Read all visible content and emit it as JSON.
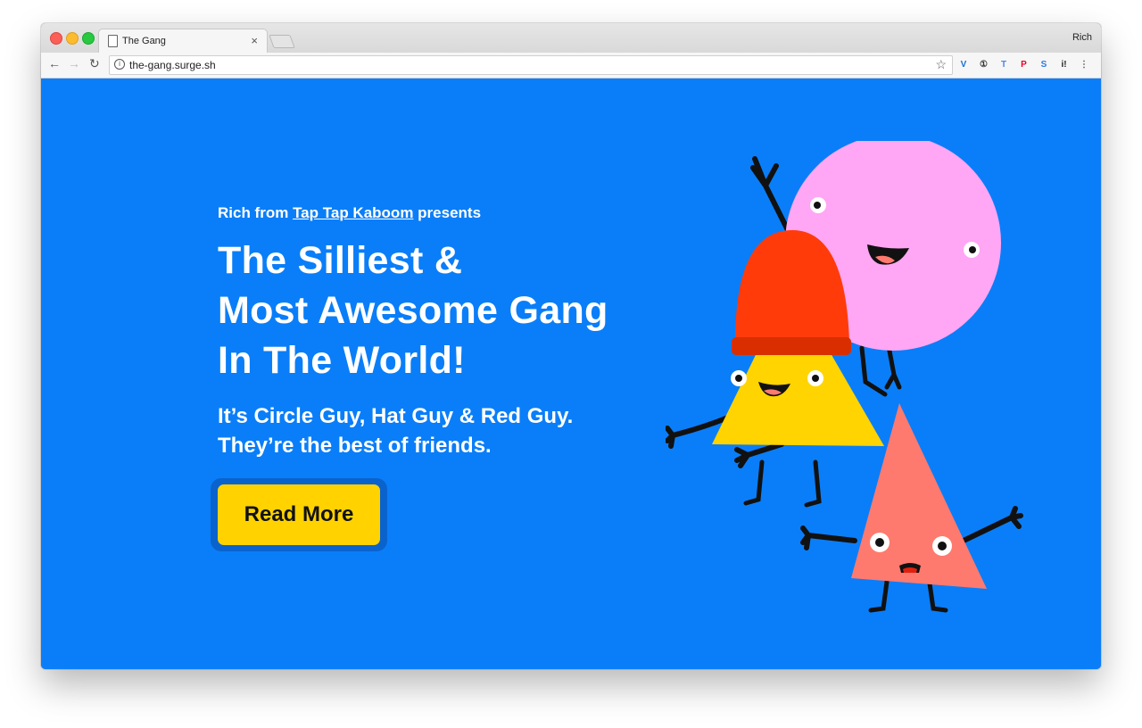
{
  "browser": {
    "tab_title": "The Gang",
    "tab_close": "×",
    "profile_name": "Rich",
    "url": "the-gang.surge.sh",
    "back": "←",
    "forward": "→",
    "reload": "↻",
    "info_glyph": "i",
    "star": "☆",
    "extensions": [
      {
        "name": "vimeo-icon",
        "glyph": "V",
        "color": "#1a6fd6"
      },
      {
        "name": "onepassword-icon",
        "glyph": "①",
        "color": "#333333"
      },
      {
        "name": "translate-icon",
        "glyph": "T",
        "color": "#4a86e8"
      },
      {
        "name": "pinterest-icon",
        "glyph": "P",
        "color": "#e60023"
      },
      {
        "name": "s-extension-icon",
        "glyph": "S",
        "color": "#2c7be5"
      },
      {
        "name": "i-extension-icon",
        "glyph": "i!",
        "color": "#222222"
      },
      {
        "name": "menu-icon",
        "glyph": "⋮",
        "color": "#555555"
      }
    ]
  },
  "hero": {
    "kicker_prefix": "Rich from ",
    "kicker_link": "Tap Tap Kaboom",
    "kicker_suffix": " presents",
    "headline_line1": "The Silliest &",
    "headline_line2": "Most Awesome Gang",
    "headline_line3": "In The World!",
    "sub_line1": "It’s Circle Guy, Hat Guy & Red Guy.",
    "sub_line2": "They’re the best of friends.",
    "cta_label": "Read More"
  },
  "colors": {
    "page_bg": "#0a7ef8",
    "cta_bg": "#ffd200",
    "circle_guy": "#ffa6f4",
    "hat": "#ff3b0a",
    "hat_guy_body": "#ffd400",
    "red_guy": "#ff7a6e"
  }
}
